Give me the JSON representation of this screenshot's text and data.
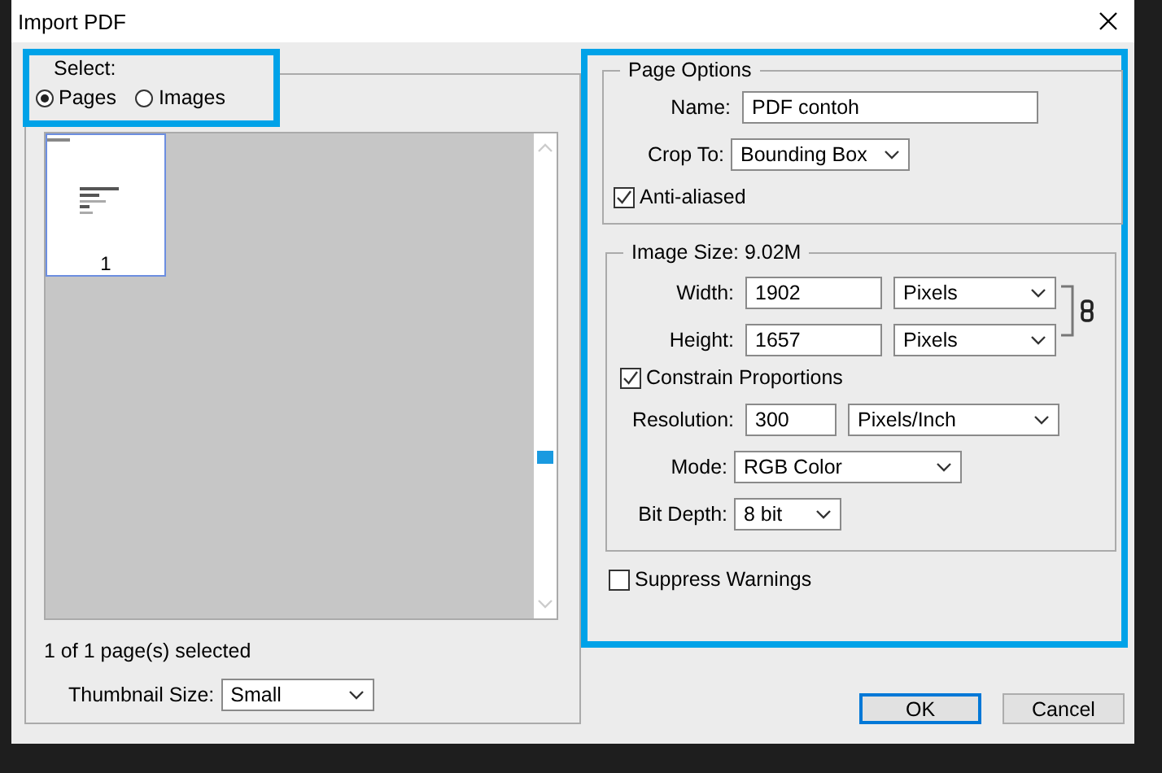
{
  "window": {
    "title": "Import PDF"
  },
  "select": {
    "label": "Select:",
    "options": [
      {
        "label": "Pages",
        "selected": true
      },
      {
        "label": "Images",
        "selected": false
      }
    ]
  },
  "thumbnails": [
    {
      "label": "1",
      "selected": true
    }
  ],
  "selection_status": "1 of 1 page(s) selected",
  "thumbnail_size": {
    "label": "Thumbnail Size:",
    "value": "Small"
  },
  "page_options": {
    "title": "Page Options",
    "name": {
      "label": "Name:",
      "value": "PDF contoh"
    },
    "crop_to": {
      "label": "Crop To:",
      "value": "Bounding Box"
    },
    "anti_aliased": {
      "label": "Anti-aliased",
      "checked": true
    }
  },
  "image_size": {
    "title": "Image Size: 9.02M",
    "width": {
      "label": "Width:",
      "value": "1902",
      "unit": "Pixels"
    },
    "height": {
      "label": "Height:",
      "value": "1657",
      "unit": "Pixels"
    },
    "constrain": {
      "label": "Constrain Proportions",
      "checked": true
    },
    "resolution": {
      "label": "Resolution:",
      "value": "300",
      "unit": "Pixels/Inch"
    },
    "mode": {
      "label": "Mode:",
      "value": "RGB Color"
    },
    "bit_depth": {
      "label": "Bit Depth:",
      "value": "8 bit"
    }
  },
  "suppress_warnings": {
    "label": "Suppress Warnings",
    "checked": false
  },
  "buttons": [
    {
      "label": "OK",
      "kind": "default"
    },
    {
      "label": "Cancel",
      "kind": "normal"
    }
  ]
}
